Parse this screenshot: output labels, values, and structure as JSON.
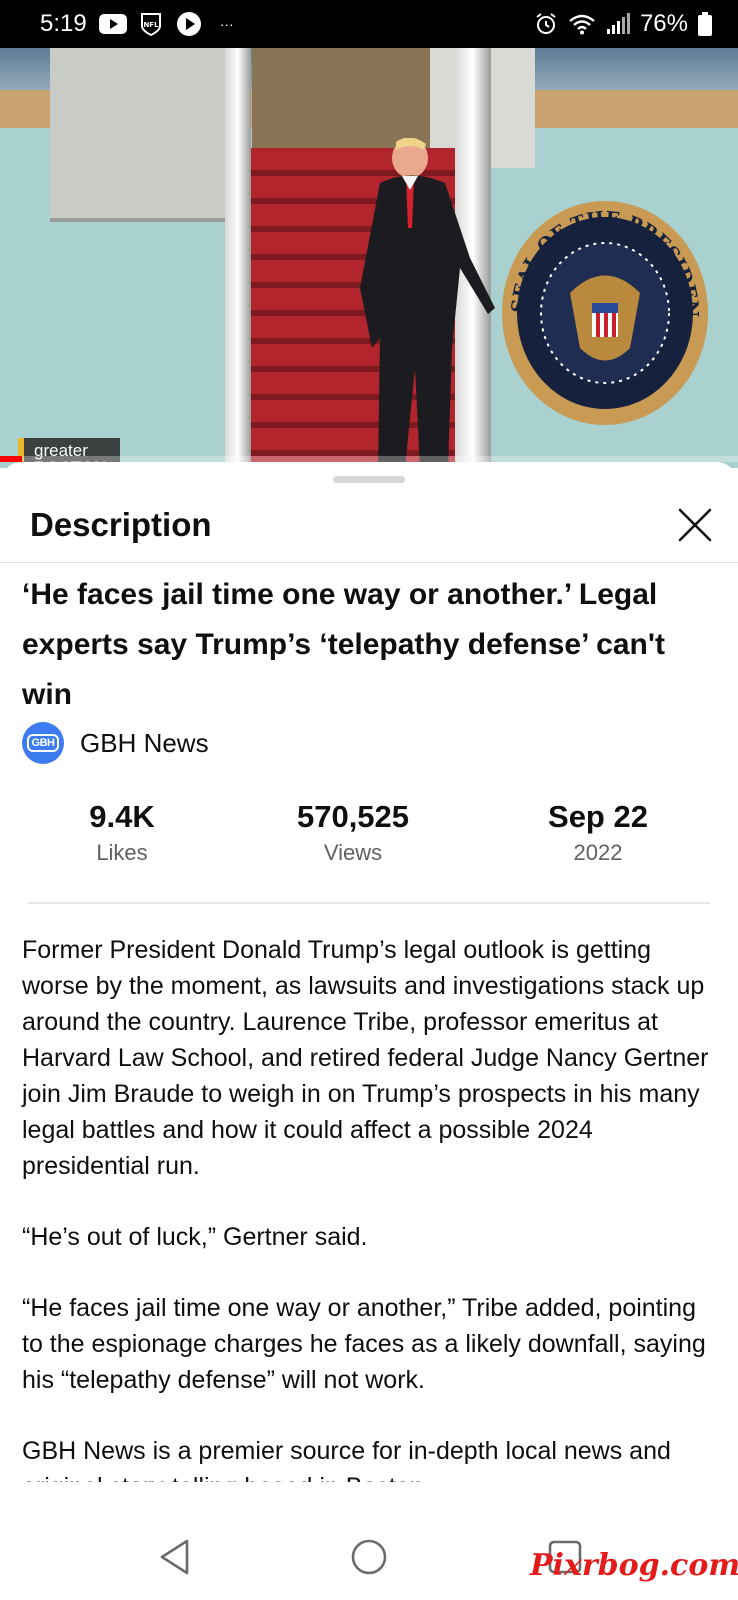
{
  "status_bar": {
    "time": "5:19",
    "battery": "76%",
    "more": "···",
    "icons": [
      "youtube-icon",
      "nfl-icon",
      "play-icon",
      "alarm-icon",
      "wifi-icon",
      "signal-icon",
      "battery-icon"
    ]
  },
  "video": {
    "overlay_logo_line1": "greater",
    "overlay_logo_line2": "BOSTON",
    "seal_text": "SEAL OF THE PRESIDENT OF THE UNITED STATES",
    "progress_fraction": 0.03,
    "progress_color": "#ff0000"
  },
  "sheet": {
    "title": "Description",
    "video_title": "‘He faces jail time one way or another.’ Legal experts say Trump’s ‘telepathy defense’ can't win",
    "channel": {
      "name": "GBH News",
      "avatar_text": "GBH",
      "avatar_color": "#3d7cf0"
    },
    "stats": [
      {
        "value": "9.4K",
        "label": "Likes"
      },
      {
        "value": "570,525",
        "label": "Views"
      },
      {
        "value": "Sep 22",
        "label": "2022"
      }
    ],
    "description": [
      "Former President Donald Trump’s legal outlook is getting worse by the moment, as lawsuits and investigations stack up around the country. Laurence Tribe, professor emeritus at Harvard Law School, and retired federal Judge Nancy Gertner join Jim Braude to weigh in on Trump’s prospects in his many legal battles and how it could affect a possible 2024 presidential run.",
      "“He’s out of luck,” Gertner said.",
      "“He faces jail time one way or another,” Tribe added, pointing to the espionage charges he faces as a likely downfall, saying his “telepathy defense” will not work.",
      "GBH News is a premier source for in-depth local news and original story-telling based in Boston."
    ]
  },
  "nav": {
    "watermark": "Pixrbog.com"
  }
}
